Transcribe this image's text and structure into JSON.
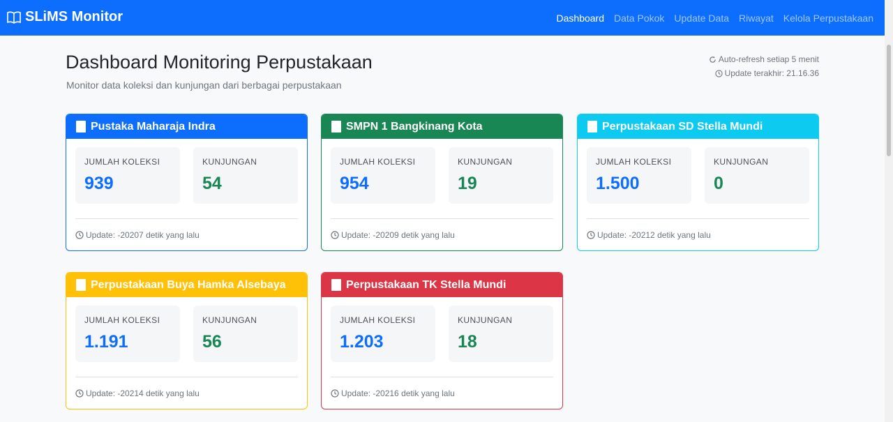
{
  "navbar": {
    "brand": "SLiMS Monitor",
    "links": [
      "Dashboard",
      "Data Pokok",
      "Update Data",
      "Riwayat",
      "Kelola Perpustakaan"
    ],
    "active_index": 0
  },
  "header": {
    "title": "Dashboard Monitoring Perpustakaan",
    "subtitle": "Monitor data koleksi dan kunjungan dari berbagai perpustakaan",
    "auto_refresh": "Auto-refresh setiap 5 menit",
    "last_update": "Update terakhir: 21.16.36"
  },
  "labels": {
    "koleksi": "JUMLAH KOLEKSI",
    "kunjungan": "KUNJUNGAN"
  },
  "libraries": [
    {
      "name": "Pustaka Maharaja Indra",
      "koleksi": "939",
      "kunjungan": "54",
      "update": "Update: -20207 detik yang lalu",
      "color": "#0d6efd"
    },
    {
      "name": "SMPN 1 Bangkinang Kota",
      "koleksi": "954",
      "kunjungan": "19",
      "update": "Update: -20209 detik yang lalu",
      "color": "#198754"
    },
    {
      "name": "Perpustakaan SD Stella Mundi",
      "koleksi": "1.500",
      "kunjungan": "0",
      "update": "Update: -20212 detik yang lalu",
      "color": "#0dcaf0"
    },
    {
      "name": "Perpustakaan Buya Hamka Alsebaya",
      "koleksi": "1.191",
      "kunjungan": "56",
      "update": "Update: -20214 detik yang lalu",
      "color": "#ffc107"
    },
    {
      "name": "Perpustakaan TK Stella Mundi",
      "koleksi": "1.203",
      "kunjungan": "18",
      "update": "Update: -20216 detik yang lalu",
      "color": "#dc3545"
    }
  ]
}
